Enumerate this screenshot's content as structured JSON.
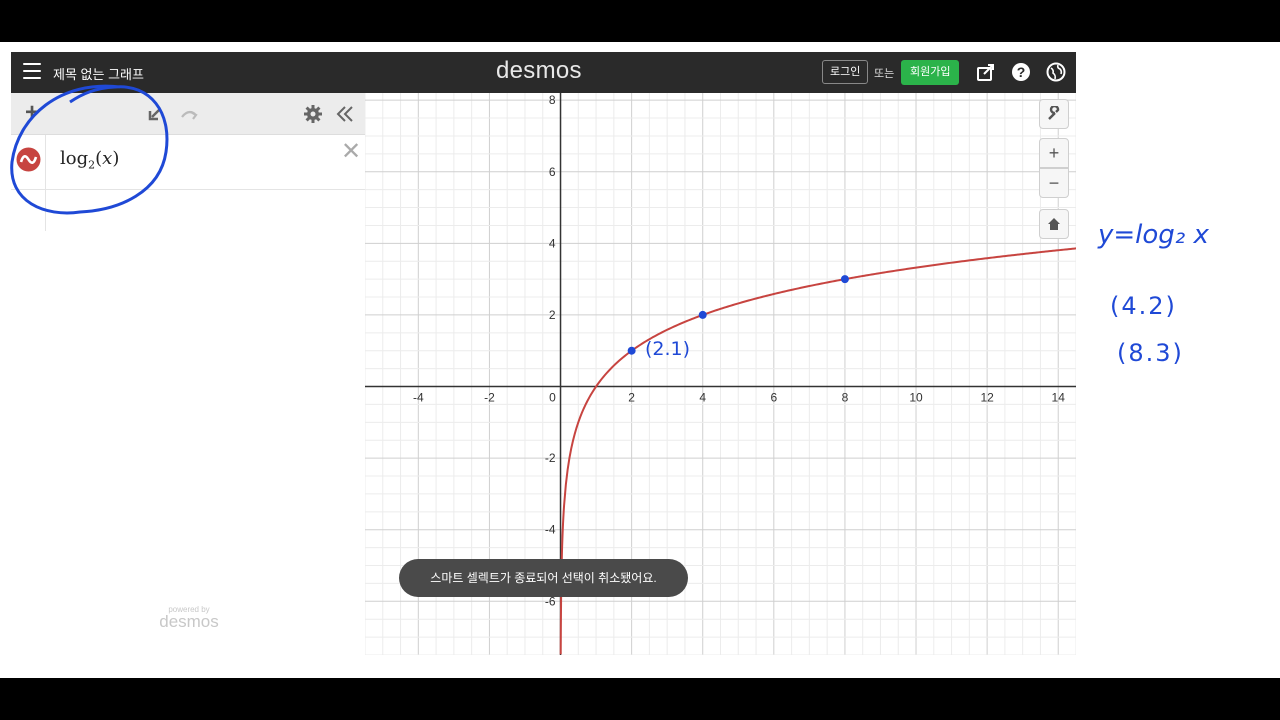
{
  "app": {
    "graph_title": "제목 없는 그래프",
    "brand": "desmos",
    "login_label": "로그인",
    "or_label": "또는",
    "signup_label": "회원가입"
  },
  "expression_panel": {
    "expressions": [
      {
        "base": "log",
        "subscript": "2",
        "argument": "x",
        "color": "#c74440"
      }
    ],
    "powered_by_small": "powered by",
    "powered_by_brand": "desmos"
  },
  "graph": {
    "x_range": [
      -5.5,
      14.5
    ],
    "y_range": [
      -7.5,
      8.2
    ],
    "x_ticks": [
      "-4",
      "-2",
      "0",
      "2",
      "4",
      "6",
      "8",
      "10",
      "12",
      "14"
    ],
    "y_ticks": [
      "8",
      "6",
      "4",
      "2",
      "-2",
      "-4",
      "-6"
    ],
    "curve": "y = log2(x)",
    "curve_color": "#c74440",
    "points": [
      {
        "x": 2,
        "y": 1
      },
      {
        "x": 4,
        "y": 2
      },
      {
        "x": 8,
        "y": 3
      }
    ],
    "point_color": "#1f49d6"
  },
  "toast": "스마트 셀렉트가 종료되어 선택이 취소됐어요.",
  "annotations": {
    "point_label": "(2.1)",
    "formula": "y=log₂ x",
    "point_42": "(4.2)",
    "point_83": "(8.3)",
    "ink_color": "#1f49d6"
  }
}
